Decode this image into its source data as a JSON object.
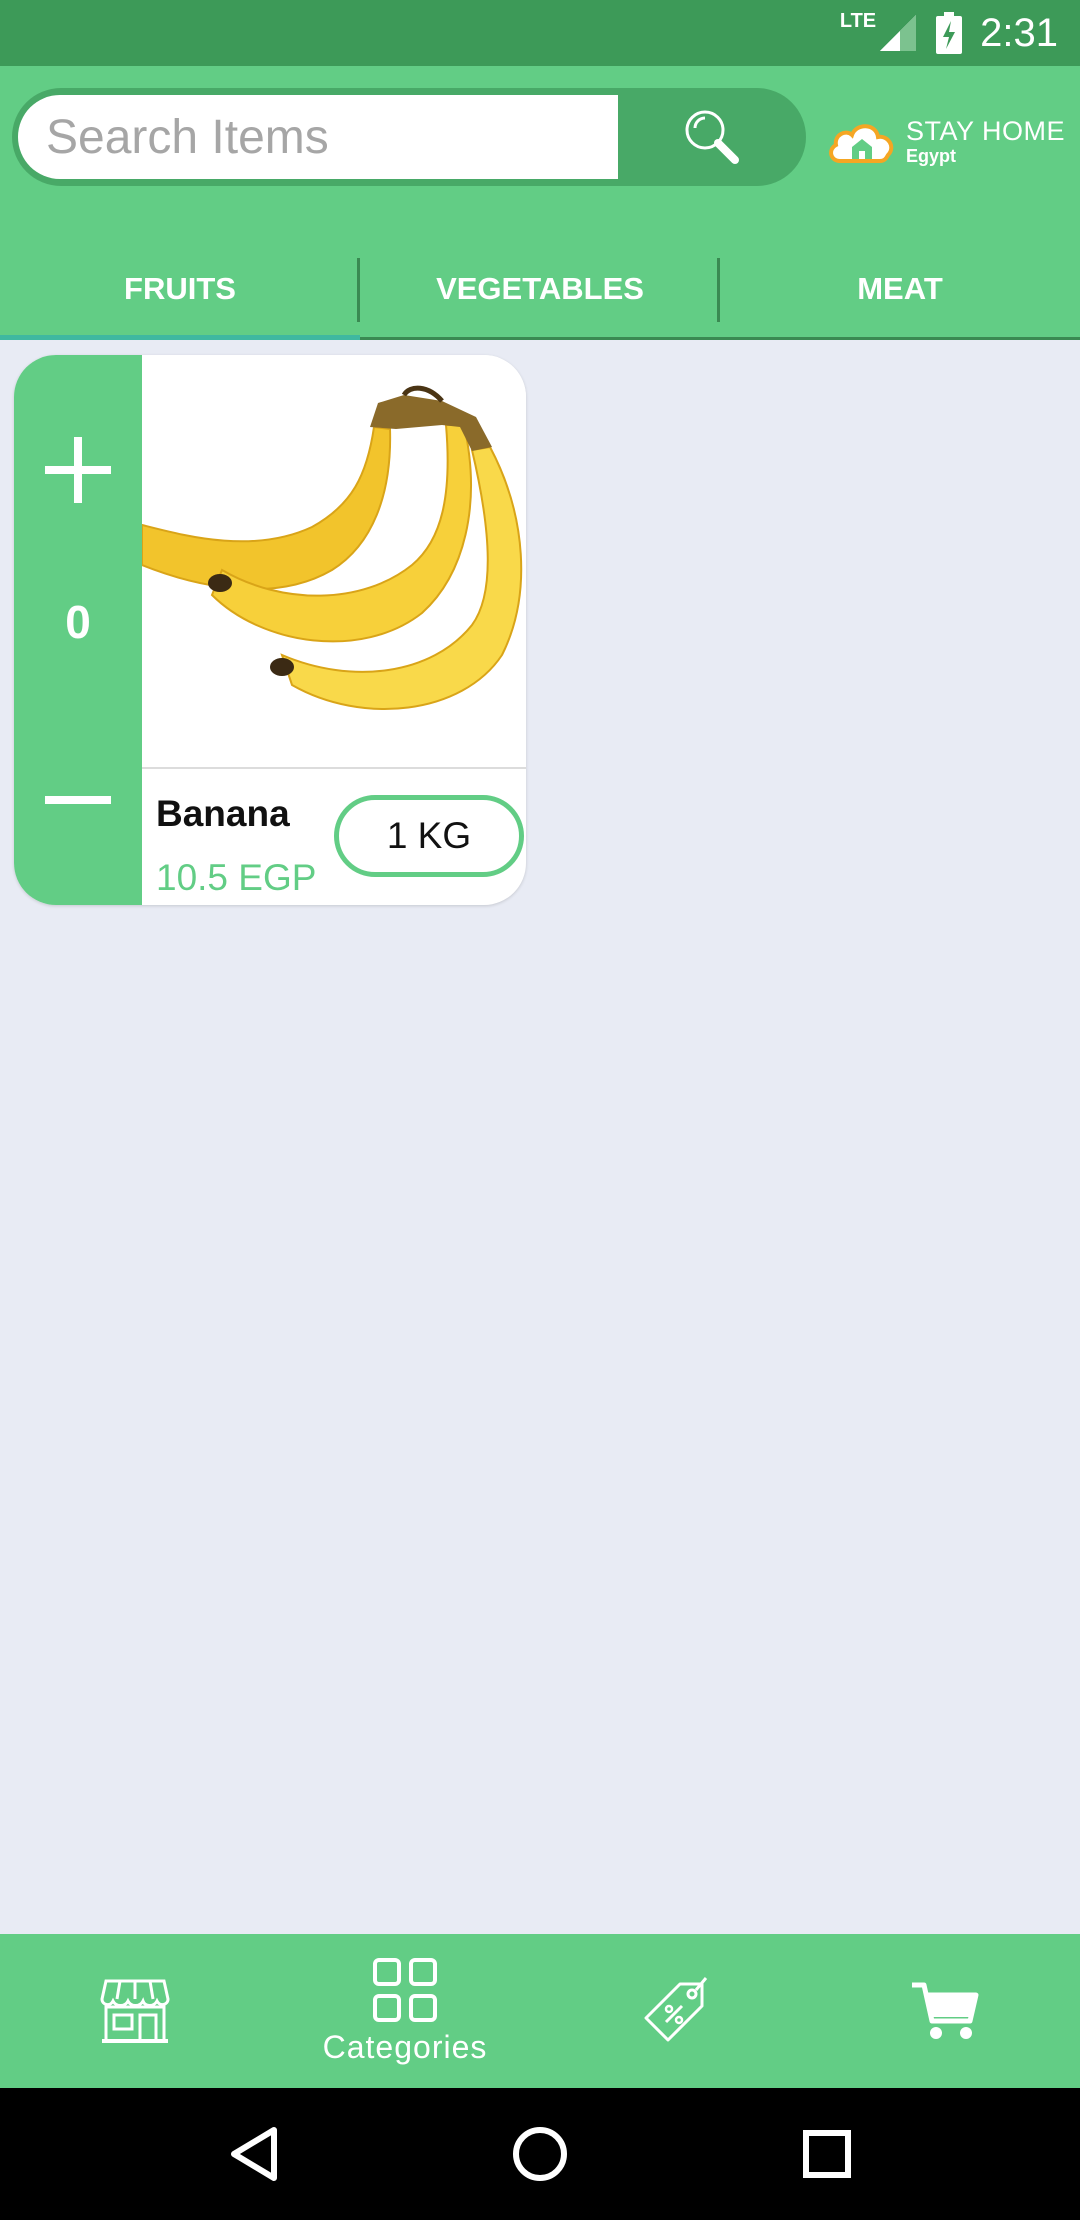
{
  "status_bar": {
    "network": "LTE",
    "time": "2:31"
  },
  "search": {
    "placeholder": "Search Items",
    "value": ""
  },
  "logo": {
    "line1": "STAY HOME",
    "line2": "Egypt"
  },
  "tabs": [
    {
      "label": "FRUITS",
      "selected": true
    },
    {
      "label": "VEGETABLES",
      "selected": false
    },
    {
      "label": "MEAT",
      "selected": false
    }
  ],
  "products": [
    {
      "name": "Banana",
      "price": "10.5 EGP",
      "quantity": "0",
      "unit": "1 KG",
      "image": "banana-image"
    }
  ],
  "bottom_nav": [
    {
      "icon": "store-icon",
      "label": ""
    },
    {
      "icon": "categories-grid-icon",
      "label": "Categories",
      "active": true
    },
    {
      "icon": "price-tag-icon",
      "label": ""
    },
    {
      "icon": "cart-icon",
      "label": ""
    }
  ],
  "colors": {
    "status_bar": "#3d9a58",
    "primary": "#62cd85",
    "primary_dark": "#48a967",
    "background": "#e8ebf4",
    "tab_indicator": "#3fb8a0",
    "logo_orange": "#f5a623"
  }
}
